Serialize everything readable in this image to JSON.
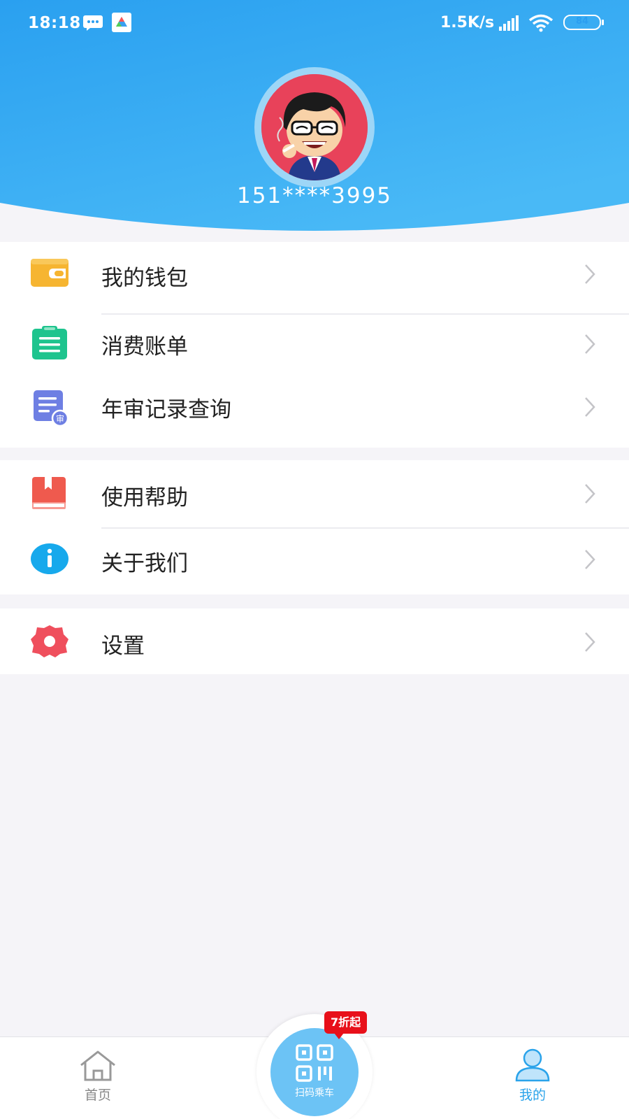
{
  "status_bar": {
    "time": "18:18",
    "net_speed": "1.5K/s",
    "battery_level": 84,
    "battery_text": "84"
  },
  "profile": {
    "phone": "151****3995"
  },
  "colors": {
    "header_top": "#2b9ef0",
    "header_bottom": "#4ab8f5",
    "wallet": "#f6b531",
    "bill": "#1ec48e",
    "review": "#6e7fe3",
    "help": "#ef5a4e",
    "about": "#17a9ec",
    "settings": "#ef4f5d",
    "tab_active": "#2aa3ea"
  },
  "menu": {
    "wallet": {
      "label": "我的钱包",
      "icon": "wallet-icon"
    },
    "bill": {
      "label": "消费账单",
      "icon": "clipboard-icon"
    },
    "review": {
      "label": "年审记录查询",
      "icon": "document-review-icon",
      "badge": "审"
    },
    "help": {
      "label": "使用帮助",
      "icon": "book-icon"
    },
    "about": {
      "label": "关于我们",
      "icon": "info-icon"
    },
    "settings": {
      "label": "设置",
      "icon": "gear-icon"
    }
  },
  "tabbar": {
    "home": {
      "label": "首页",
      "icon": "home-icon"
    },
    "scan": {
      "label": "扫码乘车",
      "icon": "qr-code-icon",
      "promo": "7折起"
    },
    "mine": {
      "label": "我的",
      "icon": "user-icon",
      "active": true
    }
  }
}
